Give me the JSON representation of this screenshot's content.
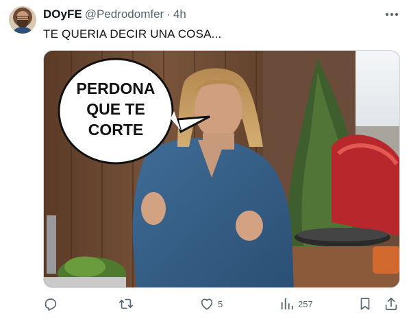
{
  "author": {
    "display_name": "DOyFE",
    "handle": "@Pedrodomfer",
    "separator": "·",
    "time": "4h"
  },
  "tweet": {
    "text": "TE QUERIA DECIR UNA COSA..."
  },
  "media": {
    "speech_bubble": "PERDONA\nQUE TE\nCORTE"
  },
  "actions": {
    "reply_icon": "reply-icon",
    "retweet_icon": "retweet-icon",
    "like_icon": "heart-icon",
    "like_count": "5",
    "views_icon": "views-icon",
    "views_count": "257",
    "bookmark_icon": "bookmark-icon",
    "share_icon": "share-icon"
  },
  "colors": {
    "text": "#0f1419",
    "secondary": "#536471",
    "border": "#cfd9de"
  }
}
